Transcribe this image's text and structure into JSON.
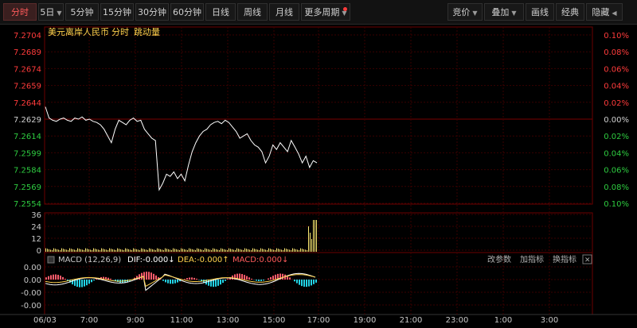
{
  "toolbar": {
    "left": [
      {
        "label": "分时",
        "active": true
      },
      {
        "label": "5日",
        "caret": true
      },
      {
        "label": "5分钟"
      },
      {
        "label": "15分钟"
      },
      {
        "label": "30分钟"
      },
      {
        "label": "60分钟"
      },
      {
        "label": "日线"
      },
      {
        "label": "周线"
      },
      {
        "label": "月线"
      },
      {
        "label": "更多周期",
        "caret": true,
        "dot": true
      }
    ],
    "right": [
      {
        "label": "竞价",
        "caret": true
      },
      {
        "label": "叠加",
        "caret": true
      },
      {
        "label": "画线"
      },
      {
        "label": "经典"
      },
      {
        "label": "隐藏",
        "arrow": true
      }
    ]
  },
  "header": {
    "symbol": "美元离岸人民币",
    "mode": "分时",
    "extra": "跳动量"
  },
  "price_axis": {
    "left": [
      "7.2704",
      "7.2689",
      "7.2674",
      "7.2659",
      "7.2644",
      "7.2629",
      "7.2614",
      "7.2599",
      "7.2584",
      "7.2569",
      "7.2554"
    ],
    "right": [
      "0.10%",
      "0.08%",
      "0.06%",
      "0.04%",
      "0.02%",
      "0.00%",
      "0.02%",
      "0.04%",
      "0.06%",
      "0.08%",
      "0.10%"
    ],
    "colors": {
      "up": "#ff3b3b",
      "flat": "#d0d0d0",
      "down": "#2ecc40"
    },
    "base": 7.2629
  },
  "volume_axis": {
    "ticks": [
      "36",
      "24",
      "12",
      "0"
    ],
    "max": 36
  },
  "macd": {
    "label": "MACD (12,26,9)",
    "dif": "DIF:-0.000↓",
    "dea": "DEA:-0.000↑",
    "macd": "MACD:0.000↓",
    "actions": [
      "改参数",
      "加指标",
      "换指标"
    ],
    "close": "✕",
    "ticks": [
      "0.00",
      "0.00",
      "-0.00",
      "-0.00"
    ]
  },
  "time_axis": [
    "06/03",
    "7:00",
    "9:00",
    "11:00",
    "13:00",
    "15:00",
    "17:00",
    "19:00",
    "21:00",
    "23:00",
    "1:00",
    "3:00"
  ],
  "chart_data": {
    "type": "line",
    "series": [
      {
        "values": [
          7.264,
          7.263,
          7.2628,
          7.2627,
          7.2629,
          7.263,
          7.2628,
          7.2627,
          7.263,
          7.2629,
          7.2631,
          7.2628,
          7.2629,
          7.2627,
          7.2626,
          7.2624,
          7.262,
          7.2614,
          7.2608,
          7.262,
          7.2628,
          7.2626,
          7.2624,
          7.2628,
          7.263,
          7.2627,
          7.2628,
          7.262,
          7.2616,
          7.2612,
          7.261,
          7.2566,
          7.2572,
          7.258,
          7.2578,
          7.2582,
          7.2576,
          7.258,
          7.2574,
          7.2588,
          7.26,
          7.2608,
          7.2614,
          7.2618,
          7.262,
          7.2624,
          7.2626,
          7.2627,
          7.2625,
          7.2628,
          7.2626,
          7.2622,
          7.2618,
          7.2612,
          7.2614,
          7.2616,
          7.261,
          7.2606,
          7.2604,
          7.26,
          7.259,
          7.2596,
          7.2606,
          7.2602,
          7.2608,
          7.2604,
          7.26,
          7.261,
          7.2604,
          7.2598,
          7.259,
          7.2596,
          7.2586,
          7.2592,
          7.259
        ]
      }
    ]
  }
}
